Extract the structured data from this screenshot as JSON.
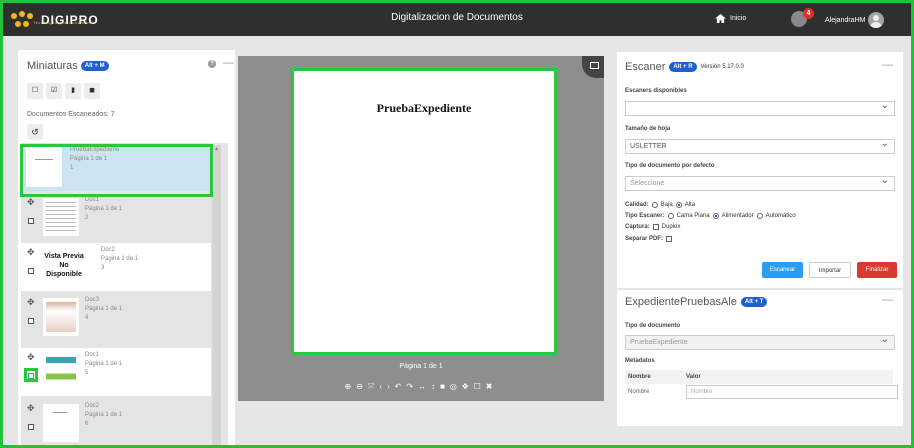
{
  "header": {
    "brand": "DIGIPRO",
    "brand_subtitle": "Tecnología que transforma",
    "title": "Digitalizacion de Documentos",
    "home_label": "Inicio",
    "notifications_count": "4",
    "user_name": "AlejandraHM"
  },
  "thumbnails_panel": {
    "title": "Miniaturas",
    "shortcut": "Alt + M",
    "docs_count_label": "Documentos Escaneados: 7",
    "items": [
      {
        "name": "PruebaExpediente",
        "page": "Página 1 de 1",
        "index": "1"
      },
      {
        "name": "Doc1",
        "page": "Página 1 de 1",
        "index": "2"
      },
      {
        "name": "Doc2",
        "page": "Página 1 de 1",
        "index": "3",
        "preview_text": "Vista Previa No Disponible"
      },
      {
        "name": "Doc3",
        "page": "Página 1 de 1",
        "index": "4"
      },
      {
        "name": "Doc1",
        "page": "Página 1 de 1",
        "index": "5"
      },
      {
        "name": "Doc2",
        "page": "Página 1 de 1",
        "index": "6"
      }
    ]
  },
  "viewer": {
    "page_heading": "PruebaExpediente",
    "page_indicator": "Página 1 de 1"
  },
  "scanner": {
    "title": "Escaner",
    "shortcut": "Alt + R",
    "version": "Versión 5.17.0.0",
    "scanners_label": "Escaners disponibles",
    "scanners_value": "",
    "sheet_size_label": "Tamaño de hoja",
    "sheet_size_value": "USLETTER",
    "doc_type_label": "Tipo de documento por defecto",
    "doc_type_value": "Seleccione",
    "quality_label": "Calidad:",
    "quality_low": "Baja",
    "quality_high": "Alta",
    "scanner_type_label": "Tipo Escaner:",
    "type_flatbed": "Cama Plana",
    "type_feeder": "Alimentador",
    "type_auto": "Automático",
    "capture_label": "Captura:",
    "capture_duplex": "Duplex",
    "split_pdf_label": "Separar PDF:",
    "btn_scan": "Escanear",
    "btn_import": "Importar",
    "btn_finish": "Finalizar"
  },
  "expediente": {
    "title": "ExpedientePruebasAle",
    "shortcut": "Alt + T",
    "doc_type_label": "Tipo de documento",
    "doc_type_value": "PruebaExpediente",
    "metadata_label": "Metadatos",
    "col_name": "Nombre",
    "col_value": "Valor",
    "rows": [
      {
        "name": "Nombre",
        "placeholder": "Nombre"
      }
    ]
  }
}
